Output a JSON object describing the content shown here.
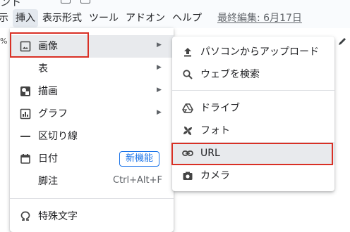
{
  "title_fragment": "ント",
  "menubar": {
    "items": [
      "示",
      "挿入",
      "表示形式",
      "ツール",
      "アドオン",
      "ヘルプ"
    ],
    "last_edit": "最終編集: 6月17日"
  },
  "toolbar": {
    "left_fragment": "%"
  },
  "insert_menu": {
    "items": [
      {
        "label": "画像",
        "icon": "image-icon",
        "has_submenu": true
      },
      {
        "label": "表",
        "icon": "",
        "has_submenu": true
      },
      {
        "label": "描画",
        "icon": "drawing-icon",
        "has_submenu": true
      },
      {
        "label": "グラフ",
        "icon": "chart-icon",
        "has_submenu": true
      },
      {
        "label": "区切り線",
        "icon": "horizontal-line-icon"
      },
      {
        "label": "日付",
        "icon": "calendar-icon",
        "badge": "新機能"
      },
      {
        "label": "脚注",
        "icon": "",
        "shortcut": "Ctrl+Alt+F"
      },
      {
        "label": "特殊文字",
        "icon": "omega-icon"
      }
    ]
  },
  "image_submenu": {
    "items": [
      {
        "label": "パソコンからアップロード",
        "icon": "upload-icon"
      },
      {
        "label": "ウェブを検索",
        "icon": "search-icon"
      },
      {
        "label": "ドライブ",
        "icon": "drive-icon"
      },
      {
        "label": "フォト",
        "icon": "photos-icon"
      },
      {
        "label": "URL",
        "icon": "link-icon"
      },
      {
        "label": "カメラ",
        "icon": "camera-icon"
      }
    ]
  },
  "colors": {
    "highlight": "#d93025",
    "badge": "#1a73e8",
    "hover": "#e8eaed"
  }
}
